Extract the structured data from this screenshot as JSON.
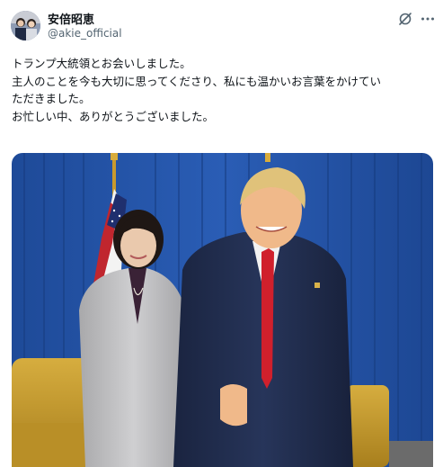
{
  "post": {
    "author": {
      "display_name": "安倍昭恵",
      "handle": "@akie_official"
    },
    "text_lines": [
      "トランプ大統領とお会いしました。",
      "主人のことを今も大切に思ってくださり、私にも温かいお言葉をかけてい",
      "ただきました。",
      "お忙しい中、ありがとうございました。"
    ],
    "icons": {
      "grok": "grok-icon",
      "more": "more-icon"
    }
  },
  "colors": {
    "text": "#0f1419",
    "secondary_text": "#536471",
    "curtain_blue": "#2455a8",
    "chair_gold": "#c49a2c",
    "suit_navy": "#1f2a44",
    "tie_red": "#d0202c",
    "jacket_gray": "#bcbcbc"
  }
}
